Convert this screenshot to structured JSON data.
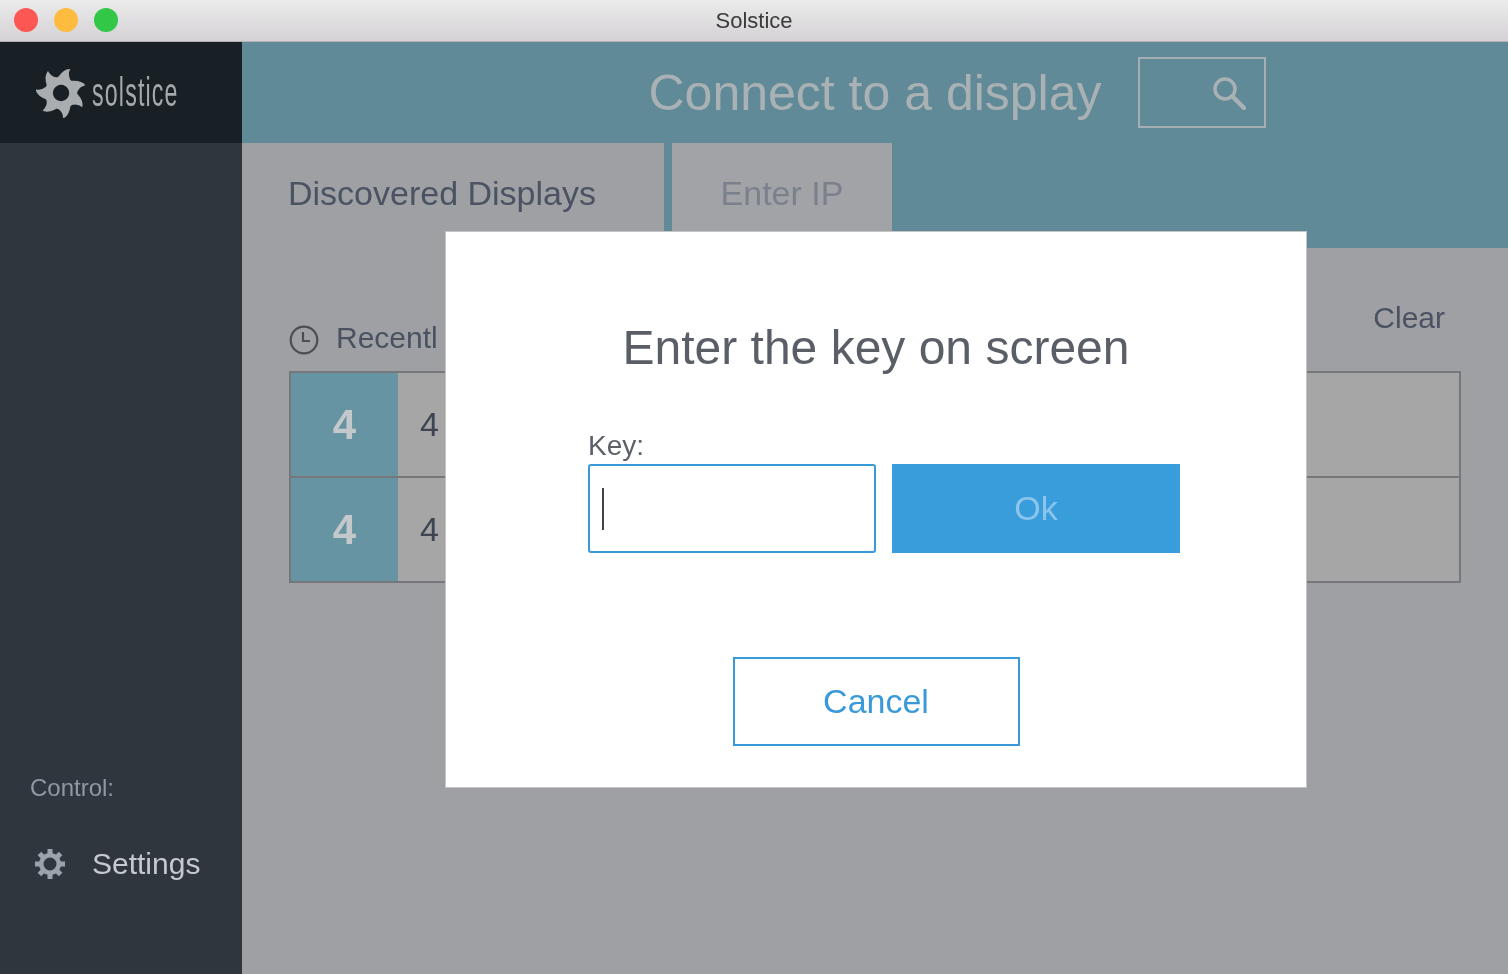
{
  "window": {
    "title": "Solstice"
  },
  "sidebar": {
    "logo_text": "solstice",
    "section_label": "Control:",
    "items": [
      {
        "label": "Settings"
      }
    ]
  },
  "header": {
    "title": "Connect to a display"
  },
  "tabs": [
    {
      "label": "Discovered Displays",
      "selected": true
    },
    {
      "label": "Enter IP",
      "selected": false
    }
  ],
  "recent": {
    "label": "Recentl",
    "clear_label": "Clear",
    "items": [
      {
        "badge": "4",
        "name": "4"
      },
      {
        "badge": "4",
        "name": "4"
      }
    ]
  },
  "dialog": {
    "title": "Enter the key on screen",
    "key_label": "Key:",
    "key_field": {
      "focused": true
    },
    "buttons": [
      {
        "label": "Ok",
        "kind": "primary",
        "disabled": true
      },
      {
        "label": "Cancel",
        "kind": "secondary",
        "disabled": false
      }
    ]
  }
}
